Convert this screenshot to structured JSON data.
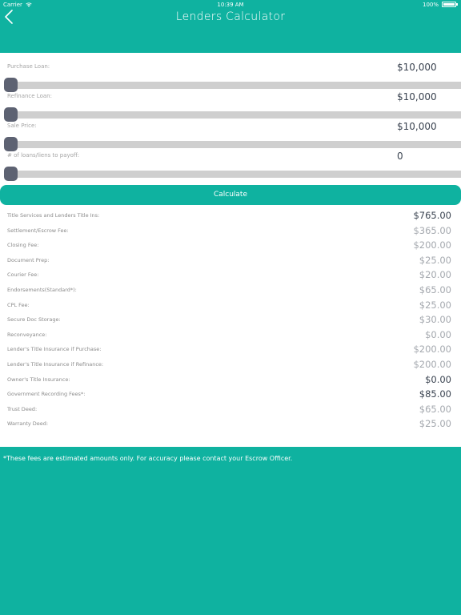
{
  "status": {
    "carrier": "Carrier",
    "time": "10:39 AM",
    "battery": "100%"
  },
  "nav": {
    "title": "Lenders Calculator"
  },
  "sliders": [
    {
      "label": "Purchase Loan:",
      "value": "$10,000",
      "level": 0
    },
    {
      "label": "Refinance Loan:",
      "value": "$10,000",
      "level": 0
    },
    {
      "label": "Sale Price:",
      "value": "$10,000",
      "level": 0
    },
    {
      "label": "# of loans/liens to payoff:",
      "value": "0",
      "level": 0
    }
  ],
  "calculate_label": "Calculate",
  "fees": [
    {
      "label": "Title Services and Lenders Title Ins:",
      "value": "$765.00",
      "emphasis": true
    },
    {
      "label": "Settlement/Escrow Fee:",
      "value": "$365.00",
      "emphasis": false
    },
    {
      "label": "Closing Fee:",
      "value": "$200.00",
      "emphasis": false
    },
    {
      "label": "Document Prep:",
      "value": "$25.00",
      "emphasis": false
    },
    {
      "label": "Courier Fee:",
      "value": "$20.00",
      "emphasis": false
    },
    {
      "label": "Endorsements(Standard*):",
      "value": "$65.00",
      "emphasis": false
    },
    {
      "label": "CPL Fee:",
      "value": "$25.00",
      "emphasis": false
    },
    {
      "label": "Secure Doc Storage:",
      "value": "$30.00",
      "emphasis": false
    },
    {
      "label": "Reconveyance:",
      "value": "$0.00",
      "emphasis": false
    },
    {
      "label": "Lender's Title Insurance if Purchase:",
      "value": "$200.00",
      "emphasis": false
    },
    {
      "label": "Lender's Title Insurance if Refinance:",
      "value": "$200.00",
      "emphasis": false
    },
    {
      "label": "Owner's Title Insurance:",
      "value": "$0.00",
      "emphasis": true
    },
    {
      "label": "Government Recording Fees*:",
      "value": "$85.00",
      "emphasis": true
    },
    {
      "label": "Trust Deed:",
      "value": "$65.00",
      "emphasis": false
    },
    {
      "label": "Warranty Deed:",
      "value": "$25.00",
      "emphasis": false
    }
  ],
  "disclaimer": "*These fees are estimated amounts only. For accuracy please contact your Escrow Officer.",
  "colors": {
    "accent": "#0fb2a0",
    "thumb": "#5d6272",
    "track": "#cfcfcf",
    "value_dark": "#3a4350",
    "value_muted": "#a5a9af"
  }
}
